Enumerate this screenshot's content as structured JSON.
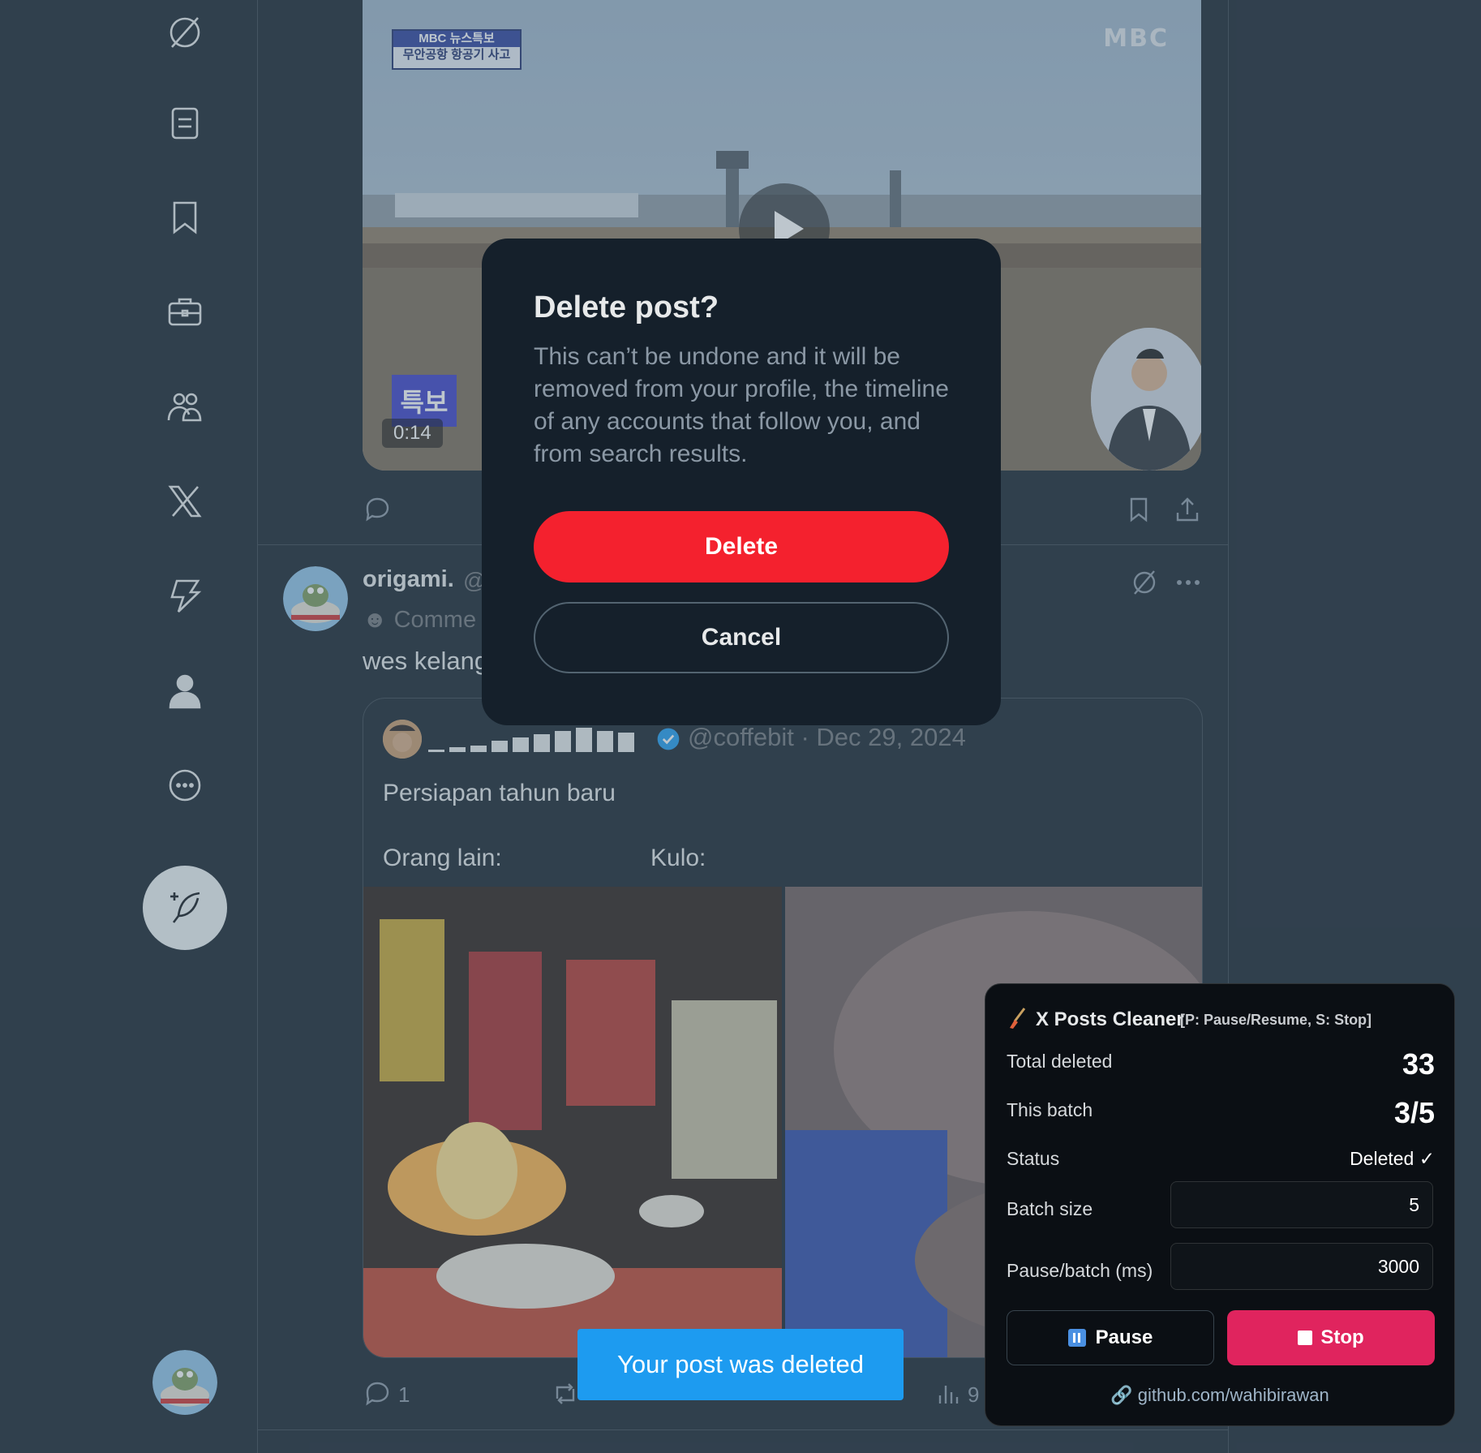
{
  "sidebar": {
    "icons": [
      "grok-icon",
      "lists-icon",
      "bookmarks-icon",
      "jobs-icon",
      "communities-icon",
      "premium-x-icon",
      "verified-orgs-icon",
      "profile-icon",
      "more-icon"
    ],
    "compose_icon": "compose-feather-icon"
  },
  "video": {
    "badge_top": "MBC 뉴스특보",
    "badge_bottom": "무안공항 항공기 사고",
    "logo": "MBC",
    "tag": "특보",
    "duration": "0:14"
  },
  "post": {
    "name": "origami.",
    "handle": "@",
    "subtitle": "Comme",
    "text": "wes kelang"
  },
  "quote": {
    "handle_date": "@coffebit · Dec 29, 2024",
    "text": "Persiapan tahun baru",
    "text_left": "Orang lain:",
    "text_right": "Kulo:"
  },
  "actions": {
    "reply_count": "1",
    "views_partial": "9"
  },
  "dialog": {
    "title": "Delete post?",
    "body": "This can’t be undone and it will be removed from your profile, the timeline of any accounts that follow you, and from search results.",
    "delete_label": "Delete",
    "cancel_label": "Cancel"
  },
  "toast": {
    "text": "Your post was deleted"
  },
  "cleaner": {
    "title": "X Posts Cleaner",
    "hint": "[P: Pause/Resume, S: Stop]",
    "total_deleted_label": "Total deleted",
    "total_deleted_value": "33",
    "this_batch_label": "This batch",
    "this_batch_value": "3/5",
    "status_label": "Status",
    "status_value": "Deleted ✓",
    "batch_size_label": "Batch size",
    "batch_size_value": "5",
    "pause_batch_label": "Pause/batch (ms)",
    "pause_batch_value": "3000",
    "pause_label": "Pause",
    "stop_label": "Stop",
    "link": "github.com/wahibirawan",
    "accent": "#e0245e"
  }
}
